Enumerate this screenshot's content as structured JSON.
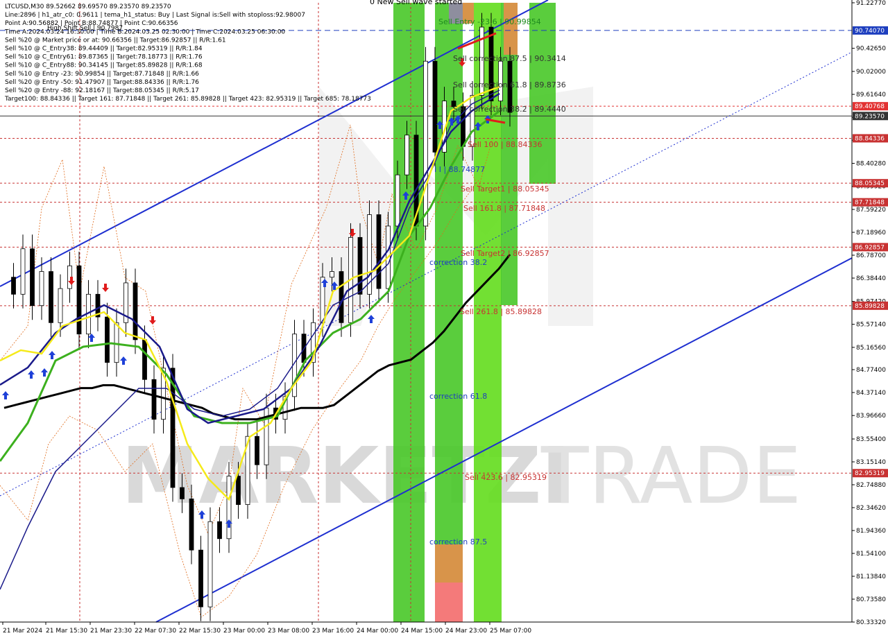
{
  "info_lines": [
    "LTCUSD,M30  89.52662 89.69570 89.23570 89.23570",
    "Line:2896 | h1_atr_c0: 0.9611 | tema_h1_status: Buy | Last Signal is:Sell with stoploss:92.98007",
    "Point A:90.56882 | Point B:88.74877 | Point C:90.66356",
    "Time A:2024.03.24 16:30:00 | Time B:2024.03.25 02:30:00 | Time C:2024.03.25 06:30:00",
    "Sell %20 @ Market price or at: 90.66356 || Target:86.92857 || R/R:1.61",
    "Sell %10 @ C_Entry38: 89.44409 || Target:82.95319 || R/R:1.84",
    "Sell %10 @ C_Entry61: 89.87365 || Target:78.18773 || R/R:1.76",
    "Sell %10 @ C_Entry88: 90.34145 || Target:85.89828 || R/R:1.68",
    "Sell %10 @ Entry -23: 90.99854 || Target:87.71848 || R/R:1.66",
    "Sell %20 @ Entry -50: 91.47907 || Target:88.84336 || R/R:1.76",
    "Sell %20 @ Entry -88: 92.18167 || Target:88.05345 || R/R:5.17",
    "Target100: 88.84336 || Target 161: 87.71848 || Target 261: 85.89828 || Target 423: 82.95319 || Target 685: 78.18773"
  ],
  "top_label": "0 New Sell wave started",
  "high_label": "High Shift Sell | 90.7987",
  "watermark": {
    "left": "MARKETZI",
    "right": "TRADE"
  },
  "chart_data": {
    "type": "candlestick",
    "symbol": "LTCUSD",
    "timeframe": "M30",
    "ohlc_last": {
      "open": 89.52662,
      "high": 89.6957,
      "low": 89.2357,
      "close": 89.2357
    },
    "ylim": [
      80.3,
      91.2
    ],
    "price_ticks": [
      "91.22770",
      "90.42650",
      "90.02000",
      "89.61640",
      "89.21280",
      "88.80920",
      "88.40280",
      "87.99920",
      "87.59220",
      "87.18960",
      "86.78700",
      "86.38440",
      "85.97420",
      "85.57140",
      "85.16560",
      "84.77400",
      "84.37140",
      "83.96660",
      "83.55400",
      "83.15140",
      "82.74880",
      "82.34620",
      "81.94360",
      "81.54100",
      "81.13840",
      "80.73580",
      "80.33320"
    ],
    "time_ticks": [
      "21 Mar 2024",
      "21 Mar 15:30",
      "21 Mar 23:30",
      "22 Mar 07:30",
      "22 Mar 15:30",
      "23 Mar 00:00",
      "23 Mar 08:00",
      "23 Mar 16:00",
      "24 Mar 00:00",
      "24 Mar 15:00",
      "24 Mar 23:00",
      "25 Mar 07:00"
    ],
    "price_tags": [
      {
        "value": 90.7407,
        "label": "90.74070",
        "color": "#1e3fbf"
      },
      {
        "value": 89.40768,
        "label": "89.40768",
        "color": "#e23232"
      },
      {
        "value": 89.2357,
        "label": "89.23570",
        "color": "#333333"
      },
      {
        "value": 88.84336,
        "label": "88.84336",
        "color": "#c83232"
      },
      {
        "value": 88.05345,
        "label": "88.05345",
        "color": "#c83232"
      },
      {
        "value": 87.71848,
        "label": "87.71848",
        "color": "#c83232"
      },
      {
        "value": 86.92857,
        "label": "86.92857",
        "color": "#c83232"
      },
      {
        "value": 85.89828,
        "label": "85.89828",
        "color": "#c83232"
      },
      {
        "value": 82.95319,
        "label": "82.95319",
        "color": "#c83232"
      }
    ],
    "levels": [
      {
        "value": 90.99854,
        "label": "Sell Entry -23.6 | 90.99854",
        "color": "#1e8a1e"
      },
      {
        "value": 90.3414,
        "label": "Sell correction 87.5 | 90.3414",
        "color": "#333333"
      },
      {
        "value": 89.8736,
        "label": "Sell correction 61.8 | 89.8736",
        "color": "#333333"
      },
      {
        "value": 89.444,
        "label": "Sell correction 38.2 | 89.4440",
        "color": "#333333"
      },
      {
        "value": 88.84336,
        "label": "Sell 100 | 88.84336",
        "color": "#c83232"
      },
      {
        "value": 88.74877,
        "label": "I I | 88.74877",
        "color": "#1e3fbf"
      },
      {
        "value": 88.05345,
        "label": "Sell Target1 | 88.05345",
        "color": "#c83232"
      },
      {
        "value": 87.71848,
        "label": "Sell 161.8 | 87.71848",
        "color": "#c83232"
      },
      {
        "value": 86.92857,
        "label": "Sell Target2 | 86.92857",
        "color": "#c83232"
      },
      {
        "value": 85.89828,
        "label": "Sell  261.8 | 85.89828",
        "color": "#c83232"
      },
      {
        "value": 82.95319,
        "label": "Sell  423.6 | 82.95319",
        "color": "#c83232"
      }
    ],
    "corrections": [
      {
        "value": 86.6,
        "label": "correction 38.2"
      },
      {
        "value": 84.3,
        "label": "correction 61.8"
      },
      {
        "value": 81.7,
        "label": "correction 87.5"
      }
    ],
    "series": [
      {
        "name": "price",
        "color": "#000000",
        "points": [
          86.4,
          86.1,
          86.9,
          85.9,
          86.5,
          85.6,
          86.2,
          86.6,
          85.4,
          86.1,
          85.7,
          84.9,
          85.6,
          86.3,
          85.3,
          84.6,
          83.9,
          84.8,
          82.7,
          82.5,
          81.6,
          80.6,
          82.1,
          81.8,
          82.9,
          82.4,
          83.6,
          83.1,
          84.1,
          83.9,
          84.3,
          85.4,
          84.9,
          85.6,
          86.4,
          86.5,
          85.6,
          87.1,
          86.1,
          87.5,
          86.2,
          87.3,
          88.2,
          88.9,
          87.3,
          90.2,
          88.6,
          89.5,
          89.4,
          88.7,
          89.6,
          90.8,
          89.5,
          90.2,
          89.3
        ]
      },
      {
        "name": "ma-black",
        "color": "#000000",
        "points": [
          84.1,
          84.15,
          84.2,
          84.25,
          84.3,
          84.35,
          84.4,
          84.45,
          84.45,
          84.5,
          84.5,
          84.45,
          84.4,
          84.35,
          84.3,
          84.25,
          84.2,
          84.15,
          84.1,
          84.0,
          83.95,
          83.9,
          83.9,
          83.9,
          83.95,
          84.0,
          84.05,
          84.1,
          84.1,
          84.1,
          84.15,
          84.3,
          84.45,
          84.6,
          84.75,
          84.85,
          84.9,
          84.95,
          85.1,
          85.25,
          85.45,
          85.7,
          85.95,
          86.15,
          86.35,
          86.55,
          86.8
        ]
      }
    ]
  }
}
